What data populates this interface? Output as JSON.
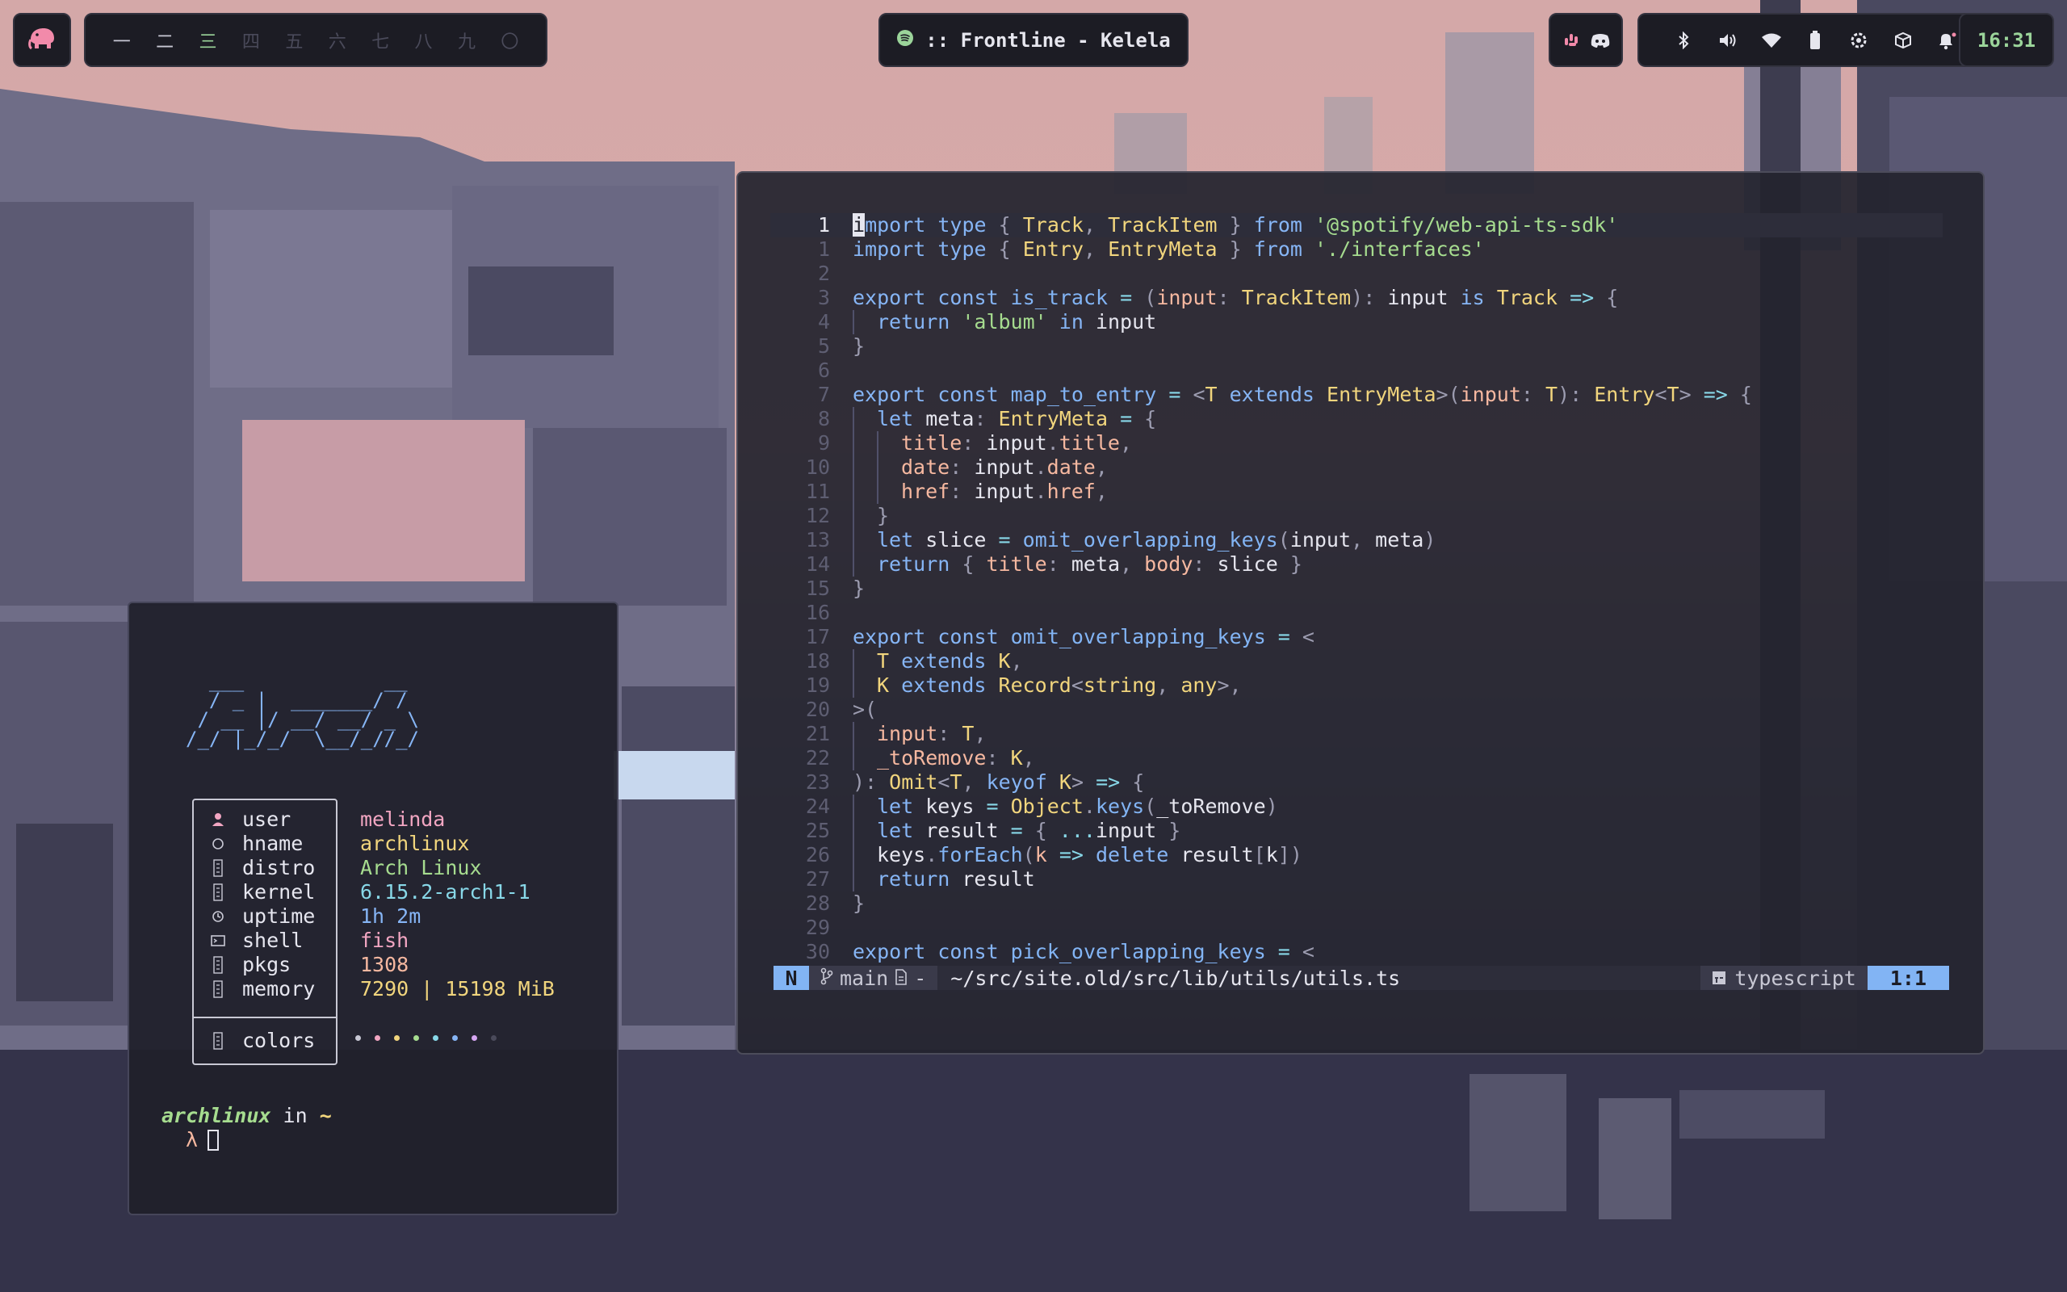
{
  "topbar": {
    "logo": "elephant-logo-icon",
    "workspaces": [
      {
        "label": "一",
        "state": "occupied"
      },
      {
        "label": "二",
        "state": "occupied"
      },
      {
        "label": "三",
        "state": "active"
      },
      {
        "label": "四",
        "state": "empty"
      },
      {
        "label": "五",
        "state": "empty"
      },
      {
        "label": "六",
        "state": "empty"
      },
      {
        "label": "七",
        "state": "empty"
      },
      {
        "label": "八",
        "state": "empty"
      },
      {
        "label": "九",
        "state": "empty"
      },
      {
        "label": "〇",
        "state": "empty"
      }
    ],
    "media": {
      "icon": "spotify-icon",
      "text": ":: Frontline - Kelela"
    },
    "apps": [
      "slack-icon",
      "discord-icon"
    ],
    "tray": [
      "bluetooth-icon",
      "volume-icon",
      "wifi-icon",
      "battery-icon",
      "settings-icon",
      "package-icon",
      "notification-bell-icon"
    ],
    "clock": "16:31",
    "accent": "#9bd49a"
  },
  "editor": {
    "lines": [
      {
        "n": "1",
        "cur": true,
        "indent": 0,
        "tokens": [
          [
            "cursorch",
            "i"
          ],
          [
            "kw",
            "mport type "
          ],
          [
            "pu",
            "{ "
          ],
          [
            "ty",
            "Track"
          ],
          [
            "pu",
            ", "
          ],
          [
            "ty",
            "TrackItem"
          ],
          [
            "pu",
            " } "
          ],
          [
            "kw",
            "from "
          ],
          [
            "st",
            "'@spotify/web-api-ts-sdk'"
          ]
        ]
      },
      {
        "n": "1",
        "indent": 0,
        "tokens": [
          [
            "kw",
            "import type "
          ],
          [
            "pu",
            "{ "
          ],
          [
            "ty",
            "Entry"
          ],
          [
            "pu",
            ", "
          ],
          [
            "ty",
            "EntryMeta"
          ],
          [
            "pu",
            " } "
          ],
          [
            "kw",
            "from "
          ],
          [
            "st",
            "'./interfaces'"
          ]
        ]
      },
      {
        "n": "2",
        "indent": 0,
        "tokens": []
      },
      {
        "n": "3",
        "indent": 0,
        "tokens": [
          [
            "kw",
            "export const "
          ],
          [
            "fn",
            "is_track"
          ],
          [
            "op",
            " = "
          ],
          [
            "pu",
            "("
          ],
          [
            "pr",
            "input"
          ],
          [
            "pu",
            ": "
          ],
          [
            "ty",
            "TrackItem"
          ],
          [
            "pu",
            "): "
          ],
          [
            "va",
            "input "
          ],
          [
            "kw",
            "is "
          ],
          [
            "ty",
            "Track"
          ],
          [
            "op",
            " => "
          ],
          [
            "pu",
            "{"
          ]
        ]
      },
      {
        "n": "4",
        "indent": 1,
        "tokens": [
          [
            "kw",
            "return "
          ],
          [
            "st",
            "'album'"
          ],
          [
            "kw",
            " in "
          ],
          [
            "va",
            "input"
          ]
        ]
      },
      {
        "n": "5",
        "indent": 0,
        "tokens": [
          [
            "pu",
            "}"
          ]
        ]
      },
      {
        "n": "6",
        "indent": 0,
        "tokens": []
      },
      {
        "n": "7",
        "indent": 0,
        "tokens": [
          [
            "kw",
            "export const "
          ],
          [
            "fn",
            "map_to_entry"
          ],
          [
            "op",
            " = "
          ],
          [
            "pu",
            "<"
          ],
          [
            "ty",
            "T "
          ],
          [
            "kw",
            "extends "
          ],
          [
            "ty",
            "EntryMeta"
          ],
          [
            "pu",
            ">("
          ],
          [
            "pr",
            "input"
          ],
          [
            "pu",
            ": "
          ],
          [
            "ty",
            "T"
          ],
          [
            "pu",
            "): "
          ],
          [
            "ty",
            "Entry"
          ],
          [
            "pu",
            "<"
          ],
          [
            "ty",
            "T"
          ],
          [
            "pu",
            "> "
          ],
          [
            "op",
            "=> "
          ],
          [
            "pu",
            "{"
          ]
        ]
      },
      {
        "n": "8",
        "indent": 1,
        "tokens": [
          [
            "kw",
            "let "
          ],
          [
            "va",
            "meta"
          ],
          [
            "pu",
            ": "
          ],
          [
            "ty",
            "EntryMeta"
          ],
          [
            "op",
            " = "
          ],
          [
            "pu",
            "{"
          ]
        ]
      },
      {
        "n": "9",
        "indent": 2,
        "tokens": [
          [
            "pr",
            "title"
          ],
          [
            "pu",
            ": "
          ],
          [
            "va",
            "input"
          ],
          [
            "pu",
            "."
          ],
          [
            "pr",
            "title"
          ],
          [
            "pu",
            ","
          ]
        ]
      },
      {
        "n": "10",
        "indent": 2,
        "tokens": [
          [
            "pr",
            "date"
          ],
          [
            "pu",
            ": "
          ],
          [
            "va",
            "input"
          ],
          [
            "pu",
            "."
          ],
          [
            "pr",
            "date"
          ],
          [
            "pu",
            ","
          ]
        ]
      },
      {
        "n": "11",
        "indent": 2,
        "tokens": [
          [
            "pr",
            "href"
          ],
          [
            "pu",
            ": "
          ],
          [
            "va",
            "input"
          ],
          [
            "pu",
            "."
          ],
          [
            "pr",
            "href"
          ],
          [
            "pu",
            ","
          ]
        ]
      },
      {
        "n": "12",
        "indent": 1,
        "tokens": [
          [
            "pu",
            "}"
          ]
        ]
      },
      {
        "n": "13",
        "indent": 1,
        "tokens": [
          [
            "kw",
            "let "
          ],
          [
            "va",
            "slice"
          ],
          [
            "op",
            " = "
          ],
          [
            "fn",
            "omit_overlapping_keys"
          ],
          [
            "pu",
            "("
          ],
          [
            "va",
            "input"
          ],
          [
            "pu",
            ", "
          ],
          [
            "va",
            "meta"
          ],
          [
            "pu",
            ")"
          ]
        ]
      },
      {
        "n": "14",
        "indent": 1,
        "tokens": [
          [
            "kw",
            "return "
          ],
          [
            "pu",
            "{ "
          ],
          [
            "pr",
            "title"
          ],
          [
            "pu",
            ": "
          ],
          [
            "va",
            "meta"
          ],
          [
            "pu",
            ", "
          ],
          [
            "pr",
            "body"
          ],
          [
            "pu",
            ": "
          ],
          [
            "va",
            "slice"
          ],
          [
            "pu",
            " }"
          ]
        ]
      },
      {
        "n": "15",
        "indent": 0,
        "tokens": [
          [
            "pu",
            "}"
          ]
        ]
      },
      {
        "n": "16",
        "indent": 0,
        "tokens": []
      },
      {
        "n": "17",
        "indent": 0,
        "tokens": [
          [
            "kw",
            "export const "
          ],
          [
            "fn",
            "omit_overlapping_keys"
          ],
          [
            "op",
            " = "
          ],
          [
            "pu",
            "<"
          ]
        ]
      },
      {
        "n": "18",
        "indent": 1,
        "tokens": [
          [
            "ty",
            "T "
          ],
          [
            "kw",
            "extends "
          ],
          [
            "ty",
            "K"
          ],
          [
            "pu",
            ","
          ]
        ]
      },
      {
        "n": "19",
        "indent": 1,
        "tokens": [
          [
            "ty",
            "K "
          ],
          [
            "kw",
            "extends "
          ],
          [
            "ty",
            "Record"
          ],
          [
            "pu",
            "<"
          ],
          [
            "ty",
            "string"
          ],
          [
            "pu",
            ", "
          ],
          [
            "ty",
            "any"
          ],
          [
            "pu",
            ">,"
          ]
        ]
      },
      {
        "n": "20",
        "indent": 0,
        "tokens": [
          [
            "pu",
            ">("
          ]
        ]
      },
      {
        "n": "21",
        "indent": 1,
        "tokens": [
          [
            "pr",
            "input"
          ],
          [
            "pu",
            ": "
          ],
          [
            "ty",
            "T"
          ],
          [
            "pu",
            ","
          ]
        ]
      },
      {
        "n": "22",
        "indent": 1,
        "tokens": [
          [
            "pr",
            "_toRemove"
          ],
          [
            "pu",
            ": "
          ],
          [
            "ty",
            "K"
          ],
          [
            "pu",
            ","
          ]
        ]
      },
      {
        "n": "23",
        "indent": 0,
        "tokens": [
          [
            "pu",
            "): "
          ],
          [
            "ty",
            "Omit"
          ],
          [
            "pu",
            "<"
          ],
          [
            "ty",
            "T"
          ],
          [
            "pu",
            ", "
          ],
          [
            "kw",
            "keyof "
          ],
          [
            "ty",
            "K"
          ],
          [
            "pu",
            "> "
          ],
          [
            "op",
            "=> "
          ],
          [
            "pu",
            "{"
          ]
        ]
      },
      {
        "n": "24",
        "indent": 1,
        "tokens": [
          [
            "kw",
            "let "
          ],
          [
            "va",
            "keys"
          ],
          [
            "op",
            " = "
          ],
          [
            "ty",
            "Object"
          ],
          [
            "pu",
            "."
          ],
          [
            "fn",
            "keys"
          ],
          [
            "pu",
            "("
          ],
          [
            "va",
            "_toRemove"
          ],
          [
            "pu",
            ")"
          ]
        ]
      },
      {
        "n": "25",
        "indent": 1,
        "tokens": [
          [
            "kw",
            "let "
          ],
          [
            "va",
            "result"
          ],
          [
            "op",
            " = "
          ],
          [
            "pu",
            "{ "
          ],
          [
            "op",
            "..."
          ],
          [
            "va",
            "input"
          ],
          [
            "pu",
            " }"
          ]
        ]
      },
      {
        "n": "26",
        "indent": 1,
        "tokens": [
          [
            "va",
            "keys"
          ],
          [
            "pu",
            "."
          ],
          [
            "fn",
            "forEach"
          ],
          [
            "pu",
            "("
          ],
          [
            "pr",
            "k"
          ],
          [
            "op",
            " => "
          ],
          [
            "kw",
            "delete "
          ],
          [
            "va",
            "result"
          ],
          [
            "pu",
            "["
          ],
          [
            "va",
            "k"
          ],
          [
            "pu",
            "])"
          ]
        ]
      },
      {
        "n": "27",
        "indent": 1,
        "tokens": [
          [
            "kw",
            "return "
          ],
          [
            "va",
            "result"
          ]
        ]
      },
      {
        "n": "28",
        "indent": 0,
        "tokens": [
          [
            "pu",
            "}"
          ]
        ]
      },
      {
        "n": "29",
        "indent": 0,
        "tokens": []
      },
      {
        "n": "30",
        "indent": 0,
        "tokens": [
          [
            "kw",
            "export const "
          ],
          [
            "fn",
            "pick_overlapping_keys"
          ],
          [
            "op",
            " = "
          ],
          [
            "pu",
            "<"
          ]
        ]
      }
    ],
    "status": {
      "mode": "N",
      "branch_icon": "git-branch-icon",
      "branch": "main",
      "file_icon": "file-icon",
      "modified": "-",
      "path": "~/src/site.old/src/lib/utils/utils.ts",
      "filetype_icon": "typescript-icon",
      "filetype": "typescript",
      "position": "1:1"
    }
  },
  "terminal": {
    "ascii_logo": "  ___            __\n  / _ |  _______/ /\n / __ |/ __/ __/ _ \\\n/_/ |_/_/  \\__/_//_/",
    "info": [
      {
        "icon": "user-icon",
        "label": "user",
        "value": "melinda",
        "color": "#f2a6c2"
      },
      {
        "icon": "host-icon",
        "label": "hname",
        "value": "archlinux",
        "color": "#f1d57d"
      },
      {
        "icon": "distro-icon",
        "label": "distro",
        "value": "Arch Linux",
        "color": "#a6dc8f"
      },
      {
        "icon": "kernel-icon",
        "label": "kernel",
        "value": "6.15.2-arch1-1",
        "color": "#88d8e8"
      },
      {
        "icon": "clock-icon",
        "label": "uptime",
        "value": "1h 2m",
        "color": "#86b5f5"
      },
      {
        "icon": "shell-icon",
        "label": "shell",
        "value": "fish",
        "color": "#f2a6c2"
      },
      {
        "icon": "package-icon",
        "label": "pkgs",
        "value": "1308",
        "color": "#f6b8a0"
      },
      {
        "icon": "memory-icon",
        "label": "memory",
        "value": "7290 | 15198 MiB",
        "color": "#f1d57d"
      }
    ],
    "colors_label": "colors",
    "palette": [
      "#c8c8d4",
      "#f2a6c2",
      "#f1d57d",
      "#a6dc8f",
      "#88d8e8",
      "#86b5f5",
      "#d6a6f2",
      "#4a4a5a"
    ],
    "prompt_host": "archlinux",
    "prompt_in": " in ",
    "prompt_dir": "~",
    "prompt_symbol": "λ"
  }
}
